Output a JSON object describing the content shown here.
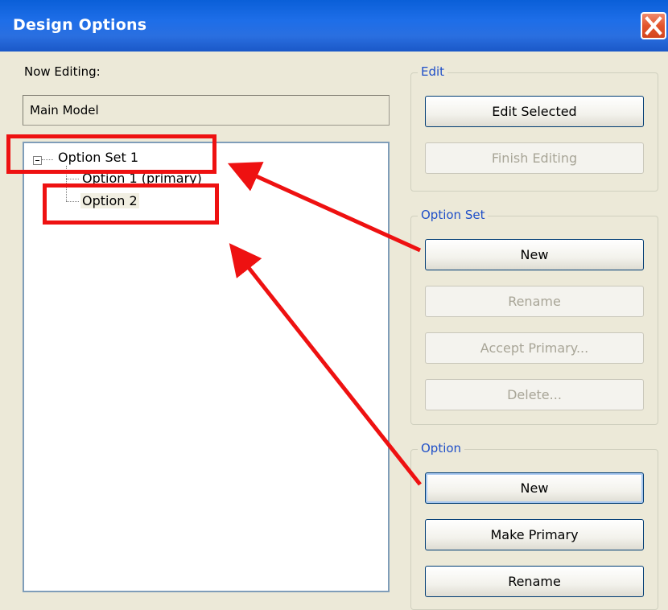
{
  "window": {
    "title": "Design Options",
    "close_icon": "close-icon"
  },
  "now_editing": {
    "label": "Now Editing:",
    "value": "Main Model"
  },
  "tree": {
    "root": {
      "label": "Option Set 1",
      "expander_icon": "collapse-icon"
    },
    "children": [
      {
        "label": "Option 1 (primary)"
      },
      {
        "label": "Option 2"
      }
    ]
  },
  "edit_group": {
    "title": "Edit",
    "edit_selected": "Edit Selected",
    "finish_editing": "Finish Editing"
  },
  "option_set_group": {
    "title": "Option Set",
    "new": "New",
    "rename": "Rename",
    "accept_primary": "Accept Primary...",
    "delete": "Delete..."
  },
  "option_group": {
    "title": "Option",
    "new": "New",
    "make_primary": "Make Primary",
    "rename": "Rename"
  },
  "annotation": {
    "color": "#ee1111"
  }
}
